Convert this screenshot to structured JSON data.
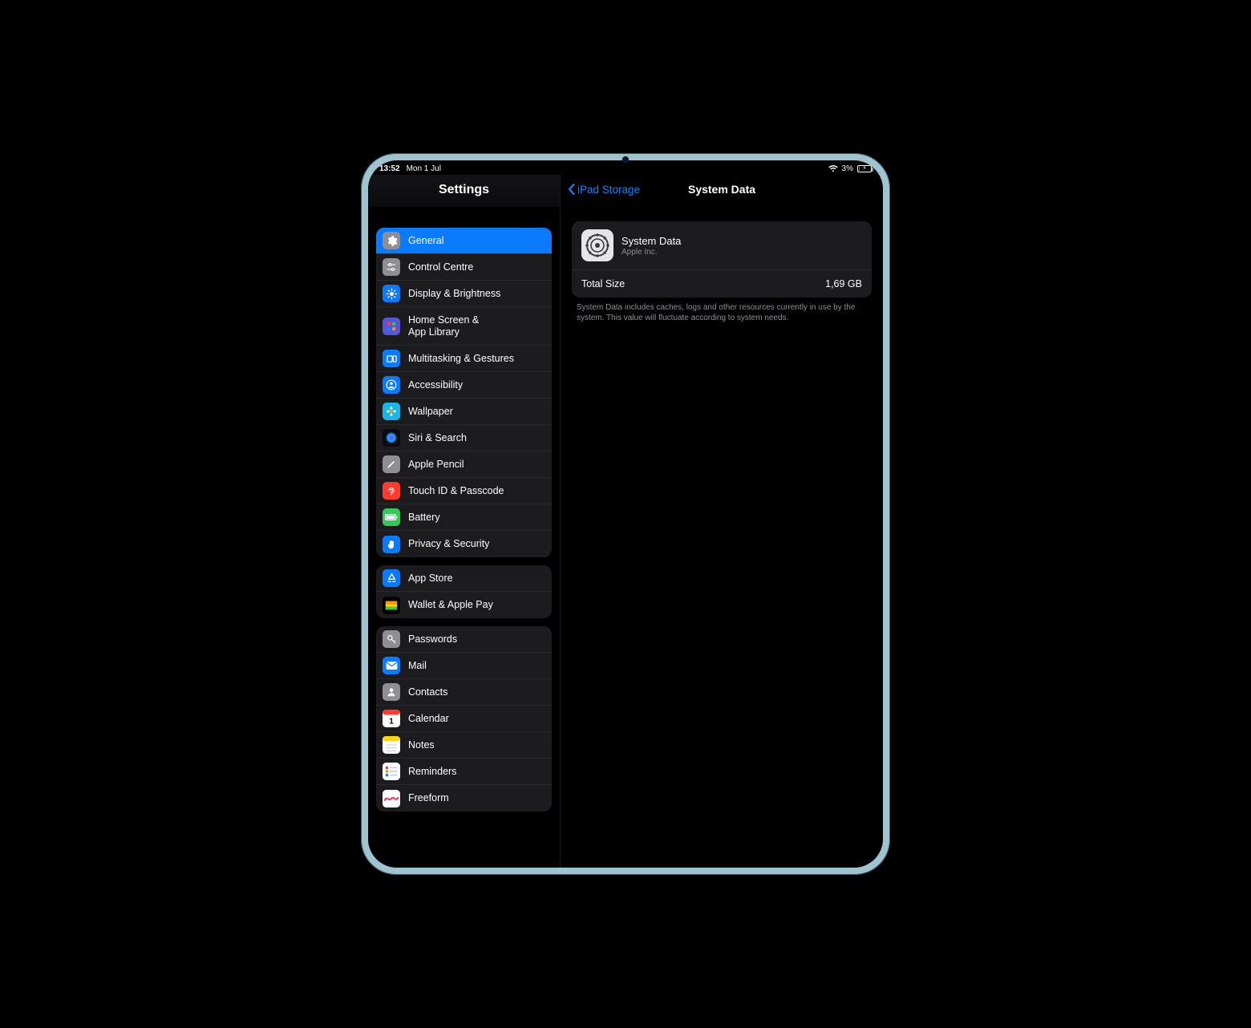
{
  "status": {
    "time": "13:52",
    "date": "Mon 1 Jul",
    "battery_pct": "3%"
  },
  "sidebar": {
    "title": "Settings",
    "groups": [
      [
        {
          "id": "general",
          "label": "General",
          "bg": "#8e8e93",
          "glyph": "gear",
          "selected": true
        },
        {
          "id": "control-centre",
          "label": "Control Centre",
          "bg": "#8e8e93",
          "glyph": "sliders"
        },
        {
          "id": "display",
          "label": "Display & Brightness",
          "bg": "#0a7aff",
          "glyph": "sun"
        },
        {
          "id": "home-screen",
          "label": "Home Screen &",
          "label2": "App Library",
          "bg": "#5856d6",
          "glyph": "grid",
          "tall": true
        },
        {
          "id": "multitask",
          "label": "Multitasking & Gestures",
          "bg": "#0a7aff",
          "glyph": "rects"
        },
        {
          "id": "accessibility",
          "label": "Accessibility",
          "bg": "#0a7aff",
          "glyph": "person"
        },
        {
          "id": "wallpaper",
          "label": "Wallpaper",
          "bg": "#18b7e8",
          "glyph": "flower"
        },
        {
          "id": "siri",
          "label": "Siri & Search",
          "bg": "#1b1b20",
          "glyph": "siri"
        },
        {
          "id": "pencil",
          "label": "Apple Pencil",
          "bg": "#8e8e93",
          "glyph": "pencil"
        },
        {
          "id": "touchid",
          "label": "Touch ID & Passcode",
          "bg": "#ff3b30",
          "glyph": "finger"
        },
        {
          "id": "battery",
          "label": "Battery",
          "bg": "#34c759",
          "glyph": "battery"
        },
        {
          "id": "privacy",
          "label": "Privacy & Security",
          "bg": "#0a7aff",
          "glyph": "hand"
        }
      ],
      [
        {
          "id": "appstore",
          "label": "App Store",
          "bg": "#0a7aff",
          "glyph": "appstore"
        },
        {
          "id": "wallet",
          "label": "Wallet & Apple Pay",
          "bg": "#000000",
          "glyph": "wallet"
        }
      ],
      [
        {
          "id": "passwords",
          "label": "Passwords",
          "bg": "#8e8e93",
          "glyph": "key"
        },
        {
          "id": "mail",
          "label": "Mail",
          "bg": "#0a7aff",
          "glyph": "mail"
        },
        {
          "id": "contacts",
          "label": "Contacts",
          "bg": "#8e8e93",
          "glyph": "contact"
        },
        {
          "id": "calendar",
          "label": "Calendar",
          "bg": "#ffffff",
          "glyph": "calendar"
        },
        {
          "id": "notes",
          "label": "Notes",
          "bg": "#ffffff",
          "glyph": "notes"
        },
        {
          "id": "reminders",
          "label": "Reminders",
          "bg": "#ffffff",
          "glyph": "reminders"
        },
        {
          "id": "freeform",
          "label": "Freeform",
          "bg": "#ffffff",
          "glyph": "freeform"
        }
      ]
    ]
  },
  "detail": {
    "back": "iPad Storage",
    "title": "System Data",
    "card": {
      "title": "System Data",
      "subtitle": "Apple Inc.",
      "size_label": "Total Size",
      "size_value": "1,69 GB"
    },
    "footer": "System Data includes caches, logs and other resources currently in use by the system. This value will fluctuate according to system needs."
  }
}
